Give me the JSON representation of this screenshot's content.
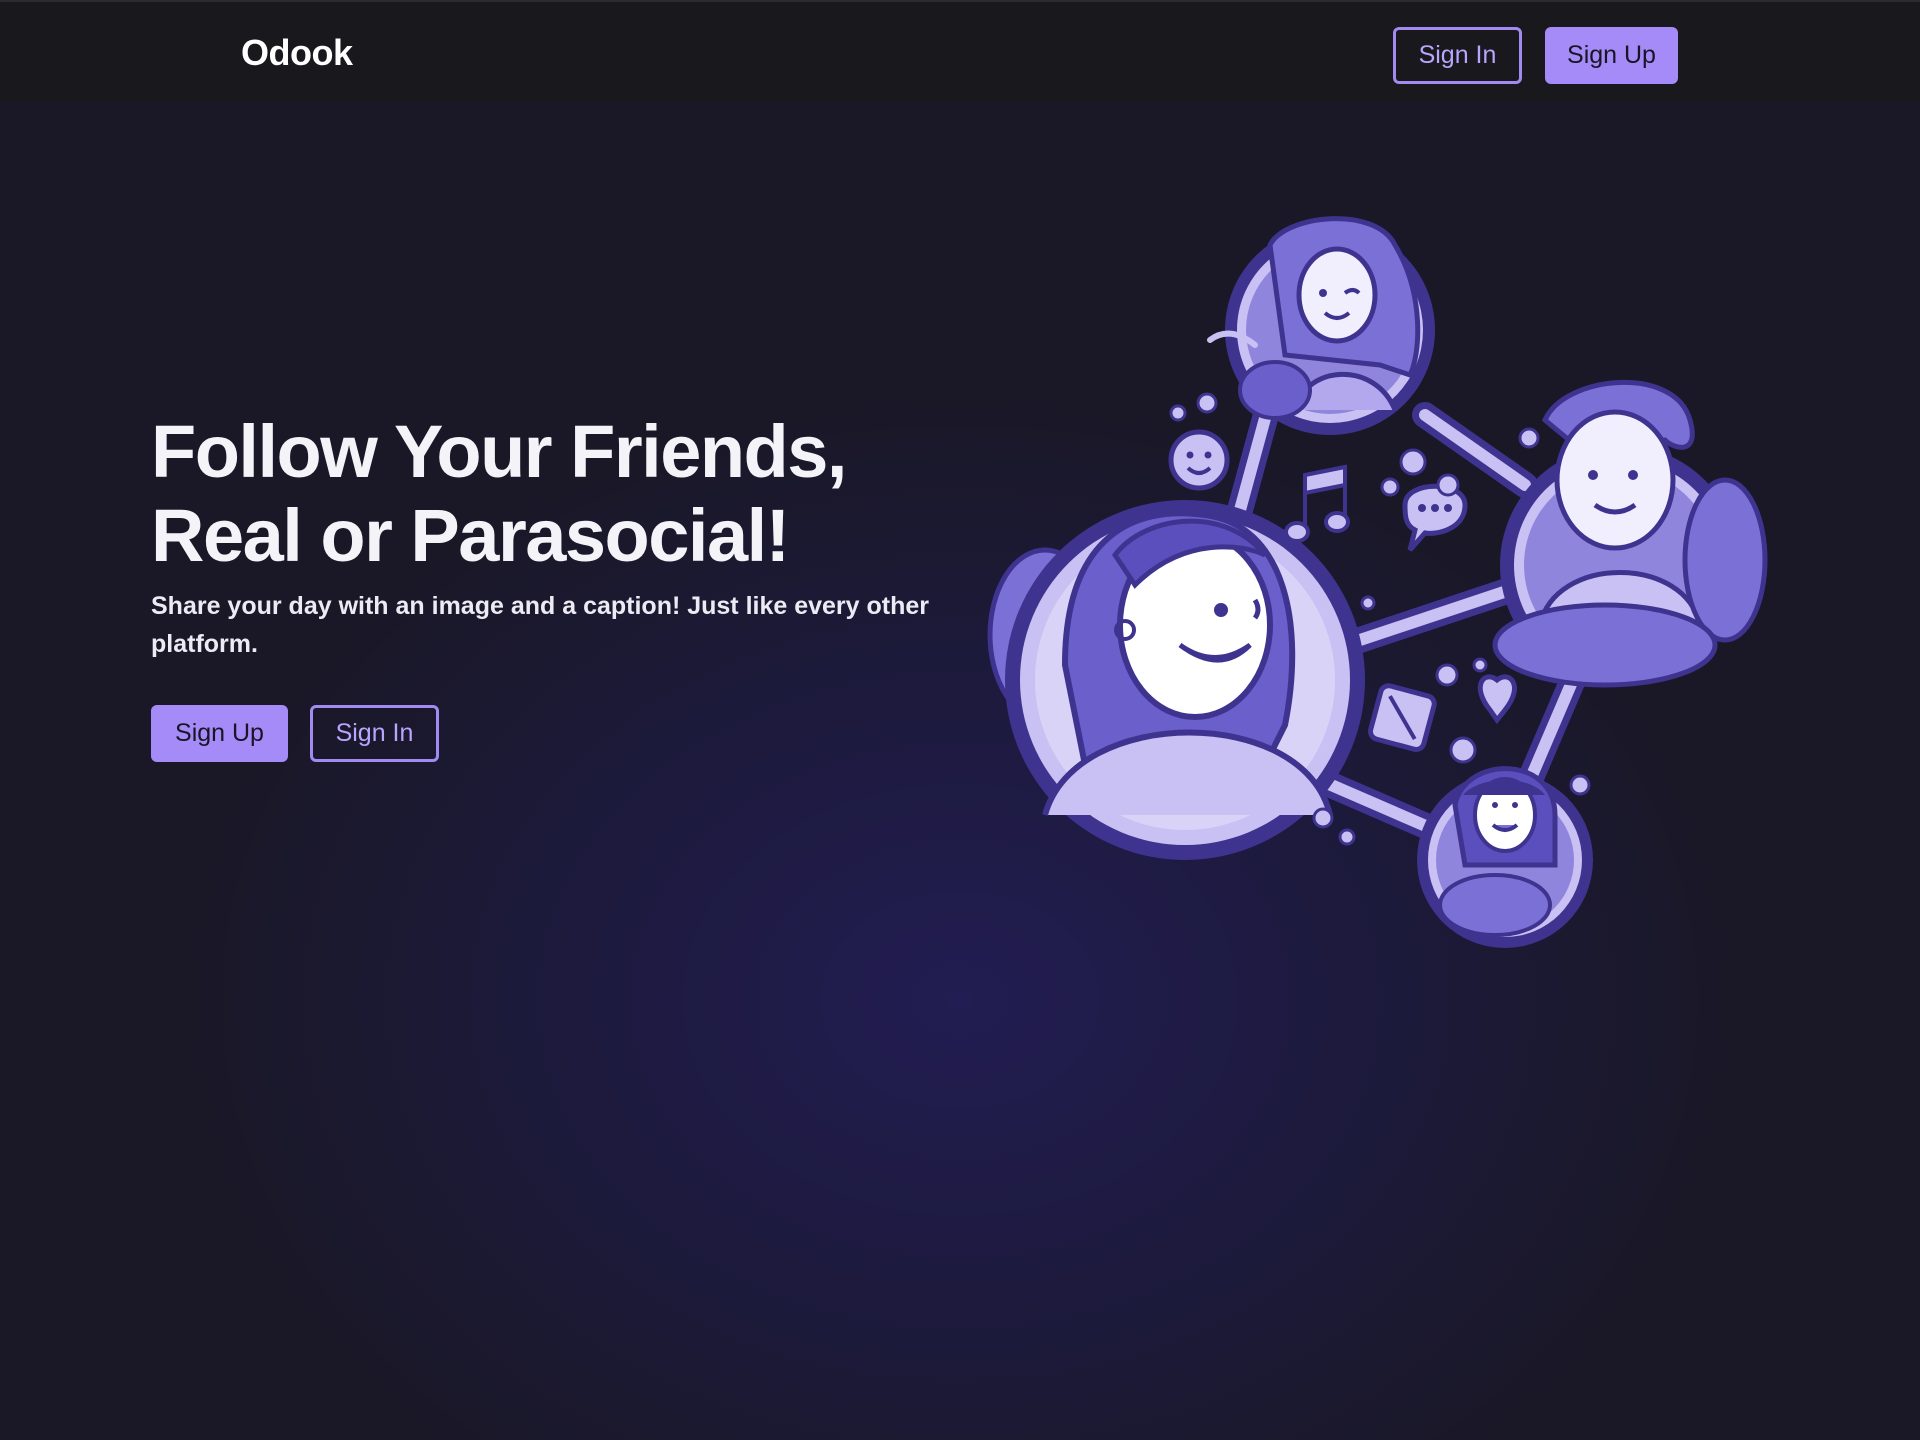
{
  "nav": {
    "brand": "Odook",
    "signin_label": "Sign In",
    "signup_label": "Sign Up"
  },
  "hero": {
    "title_line1": "Follow Your Friends,",
    "title_line2": "Real or Parasocial!",
    "subtitle": "Share your day with an image and a caption! Just like every other platform.",
    "signup_label": "Sign Up",
    "signin_label": "Sign In"
  },
  "colors": {
    "accent": "#a58bf7",
    "navbar_bg": "#19181c",
    "page_bg": "#1d1a3f",
    "illustration_dark": "#3e3490",
    "illustration_mid": "#7b70d6",
    "illustration_light": "#c9c1f3"
  },
  "illustration": {
    "icon": "friends-network-illustration"
  }
}
